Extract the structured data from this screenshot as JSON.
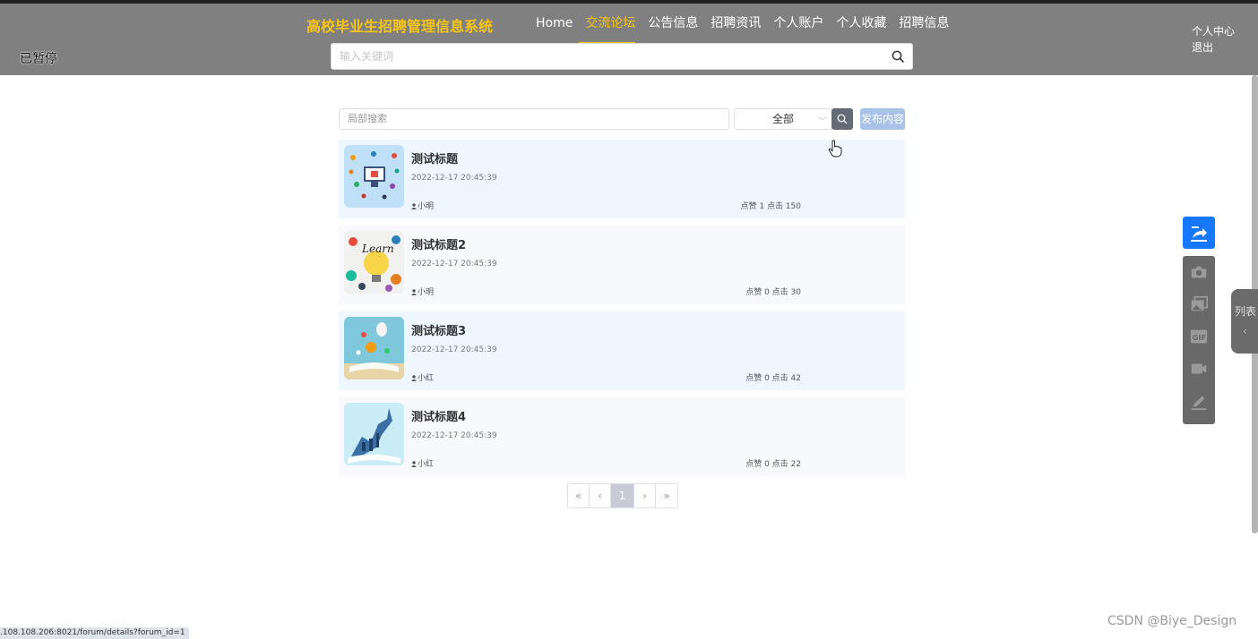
{
  "header": {
    "paused_label": "已暂停",
    "site_title": "高校毕业生招聘管理信息系统",
    "nav": [
      "Home",
      "交流论坛",
      "公告信息",
      "招聘资讯",
      "个人账户",
      "个人收藏",
      "招聘信息"
    ],
    "active_nav": "交流论坛",
    "user_center": "个人中心",
    "logout": "退出",
    "search_placeholder": "输入关键词"
  },
  "toolbar": {
    "local_search_placeholder": "局部搜索",
    "select_value": "全部",
    "publish_label": "发布内容"
  },
  "posts": [
    {
      "title": "测试标题",
      "date": "2022-12-17 20:45:39",
      "author": "小明",
      "stats": "点赞 1 点击 150",
      "thumb": "computer-icons"
    },
    {
      "title": "测试标题2",
      "date": "2022-12-17 20:45:39",
      "author": "小明",
      "stats": "点赞 0 点击 30",
      "thumb": "learn-lightbulb"
    },
    {
      "title": "测试标题3",
      "date": "2022-12-17 20:45:39",
      "author": "小红",
      "stats": "点赞 0 点击 42",
      "thumb": "open-book-balloon"
    },
    {
      "title": "测试标题4",
      "date": "2022-12-17 20:45:39",
      "author": "小红",
      "stats": "点赞 0 点击 22",
      "thumb": "book-city"
    }
  ],
  "pagination": {
    "first": "«",
    "prev": "‹",
    "current": "1",
    "next": "›",
    "last": "»"
  },
  "side_tab_label": "列表",
  "status_url": ".108.108.206:8021/forum/details?forum_id=1",
  "watermark": "CSDN @Biye_Design",
  "colors": {
    "header_bg": "#808080",
    "accent": "#f7c515",
    "primary": "#1677ff"
  }
}
